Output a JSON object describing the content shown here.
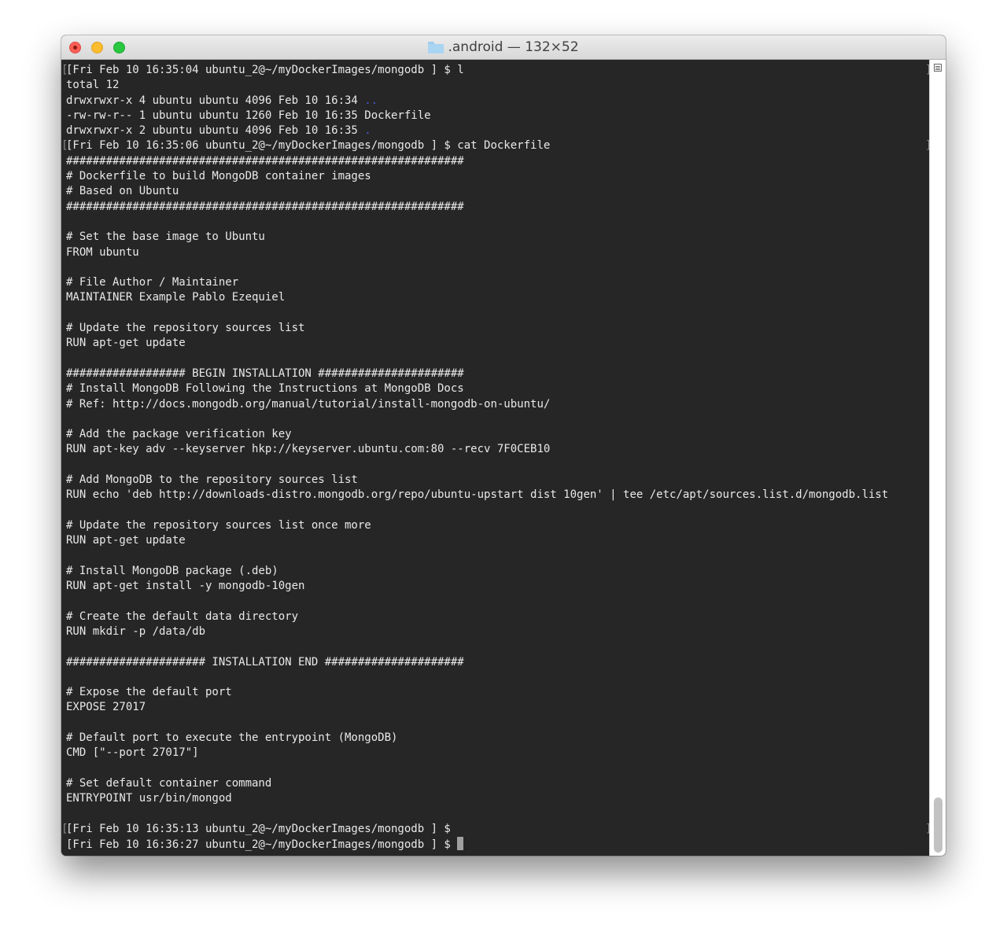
{
  "window": {
    "title": ".android — 132×52"
  },
  "terminal": {
    "lines": [
      {
        "text": "[Fri Feb 10 16:35:04 ubuntu_2@~/myDockerImages/mongodb ] $ l",
        "markLeft": "[",
        "markRight": "]"
      },
      {
        "text": "total 12"
      },
      {
        "text": "drwxrwxr-x 4 ubuntu ubuntu 4096 Feb 10 16:34 ",
        "dir": ".."
      },
      {
        "text": "-rw-rw-r-- 1 ubuntu ubuntu 1260 Feb 10 16:35 Dockerfile"
      },
      {
        "text": "drwxrwxr-x 2 ubuntu ubuntu 4096 Feb 10 16:35 ",
        "dir": "."
      },
      {
        "text": "[Fri Feb 10 16:35:06 ubuntu_2@~/myDockerImages/mongodb ] $ cat Dockerfile",
        "markLeft": "[",
        "markRight": "]"
      },
      {
        "text": "############################################################"
      },
      {
        "text": "# Dockerfile to build MongoDB container images"
      },
      {
        "text": "# Based on Ubuntu"
      },
      {
        "text": "############################################################"
      },
      {
        "text": ""
      },
      {
        "text": "# Set the base image to Ubuntu"
      },
      {
        "text": "FROM ubuntu"
      },
      {
        "text": ""
      },
      {
        "text": "# File Author / Maintainer"
      },
      {
        "text": "MAINTAINER Example Pablo Ezequiel"
      },
      {
        "text": ""
      },
      {
        "text": "# Update the repository sources list"
      },
      {
        "text": "RUN apt-get update"
      },
      {
        "text": ""
      },
      {
        "text": "################## BEGIN INSTALLATION ######################"
      },
      {
        "text": "# Install MongoDB Following the Instructions at MongoDB Docs"
      },
      {
        "text": "# Ref: http://docs.mongodb.org/manual/tutorial/install-mongodb-on-ubuntu/"
      },
      {
        "text": ""
      },
      {
        "text": "# Add the package verification key"
      },
      {
        "text": "RUN apt-key adv --keyserver hkp://keyserver.ubuntu.com:80 --recv 7F0CEB10"
      },
      {
        "text": ""
      },
      {
        "text": "# Add MongoDB to the repository sources list"
      },
      {
        "text": "RUN echo 'deb http://downloads-distro.mongodb.org/repo/ubuntu-upstart dist 10gen' | tee /etc/apt/sources.list.d/mongodb.list"
      },
      {
        "text": ""
      },
      {
        "text": "# Update the repository sources list once more"
      },
      {
        "text": "RUN apt-get update"
      },
      {
        "text": ""
      },
      {
        "text": "# Install MongoDB package (.deb)"
      },
      {
        "text": "RUN apt-get install -y mongodb-10gen"
      },
      {
        "text": ""
      },
      {
        "text": "# Create the default data directory"
      },
      {
        "text": "RUN mkdir -p /data/db"
      },
      {
        "text": ""
      },
      {
        "text": "##################### INSTALLATION END #####################"
      },
      {
        "text": ""
      },
      {
        "text": "# Expose the default port"
      },
      {
        "text": "EXPOSE 27017"
      },
      {
        "text": ""
      },
      {
        "text": "# Default port to execute the entrypoint (MongoDB)"
      },
      {
        "text": "CMD [\"--port 27017\"]"
      },
      {
        "text": ""
      },
      {
        "text": "# Set default container command"
      },
      {
        "text": "ENTRYPOINT usr/bin/mongod"
      },
      {
        "text": ""
      },
      {
        "text": "[Fri Feb 10 16:35:13 ubuntu_2@~/myDockerImages/mongodb ] $",
        "markLeft": "[",
        "markRight": "]"
      },
      {
        "text": "[Fri Feb 10 16:36:27 ubuntu_2@~/myDockerImages/mongodb ] $ ",
        "cursor": true
      }
    ]
  },
  "colors": {
    "background": "#262626",
    "foreground": "#e9e9e9",
    "directory": "#4c5bd4"
  },
  "icons": {
    "folder": "folder-icon",
    "scrollbar_menu": "hamburger-menu-icon"
  }
}
